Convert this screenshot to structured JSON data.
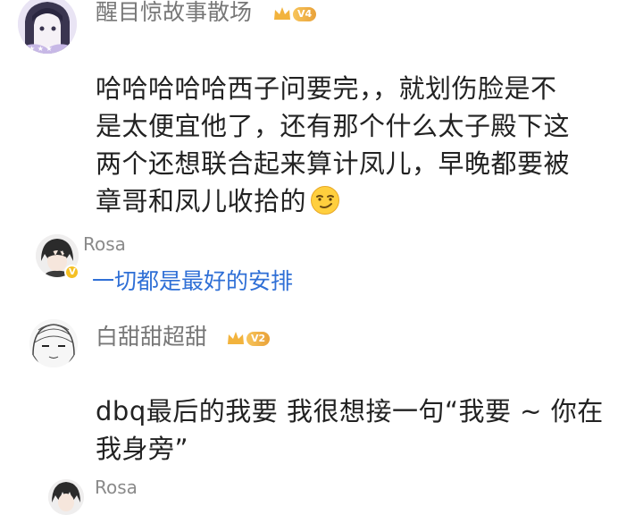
{
  "comments": [
    {
      "username": "醒目惊故事散场",
      "level": "V4",
      "avatar_icon": "anime-girl-avatar",
      "text_lines": [
        "哈哈哈哈哈西子问要完，，就划伤脸是不",
        "是太便宜他了，还有那个什么太子殿下这",
        "两个还想联合起来算计凤儿，早晚都要被",
        "章哥和凤儿收拾的"
      ],
      "emoji": "smirk-emoji",
      "reply": {
        "username": "Rosa",
        "text": "一切都是最好的安排",
        "verified": true
      }
    },
    {
      "username": "白甜甜超甜",
      "level": "V2",
      "avatar_icon": "sketch-girl-avatar",
      "text_lines": [
        "dbq最后的我要 我很想接一句“我要 ~ 你在",
        "我身旁”"
      ],
      "reply": {
        "username": "Rosa",
        "verified": true
      }
    }
  ],
  "colors": {
    "username": "#777777",
    "body_text": "#222222",
    "reply_link": "#2f6fd6",
    "badge_gold": "#f0b03f",
    "background": "#ffffff"
  }
}
